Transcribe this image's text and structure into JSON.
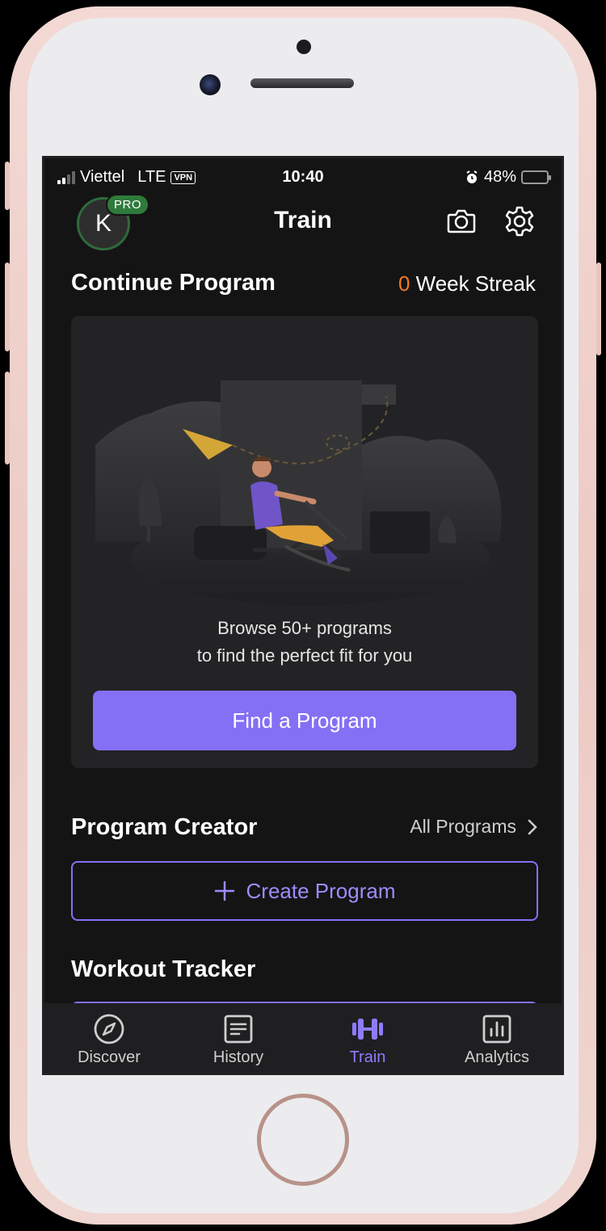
{
  "status_bar": {
    "carrier": "Viettel",
    "network": "LTE",
    "vpn": "VPN",
    "time": "10:40",
    "battery": "48%",
    "battery_level": 0.48
  },
  "header": {
    "avatar_initial": "K",
    "pro_badge": "PRO",
    "title": "Train",
    "icons": [
      "camera-icon",
      "gear-icon"
    ]
  },
  "continue_program": {
    "title": "Continue Program",
    "streak_count": "0",
    "streak_label": " Week Streak",
    "card_line1": "Browse 50+ programs",
    "card_line2": "to find the perfect fit for you",
    "button": "Find a Program"
  },
  "program_creator": {
    "title": "Program Creator",
    "link": "All Programs",
    "button": "Create Program"
  },
  "workout_tracker": {
    "title": "Workout Tracker"
  },
  "tabs": [
    {
      "label": "Discover",
      "icon": "compass-icon",
      "active": false
    },
    {
      "label": "History",
      "icon": "history-icon",
      "active": false
    },
    {
      "label": "Train",
      "icon": "dumbbell-icon",
      "active": true
    },
    {
      "label": "Analytics",
      "icon": "chart-icon",
      "active": false
    }
  ],
  "colors": {
    "accent": "#8470f5",
    "streak": "#f07a24",
    "pro_badge": "#2f7a3b",
    "background": "#141414"
  }
}
